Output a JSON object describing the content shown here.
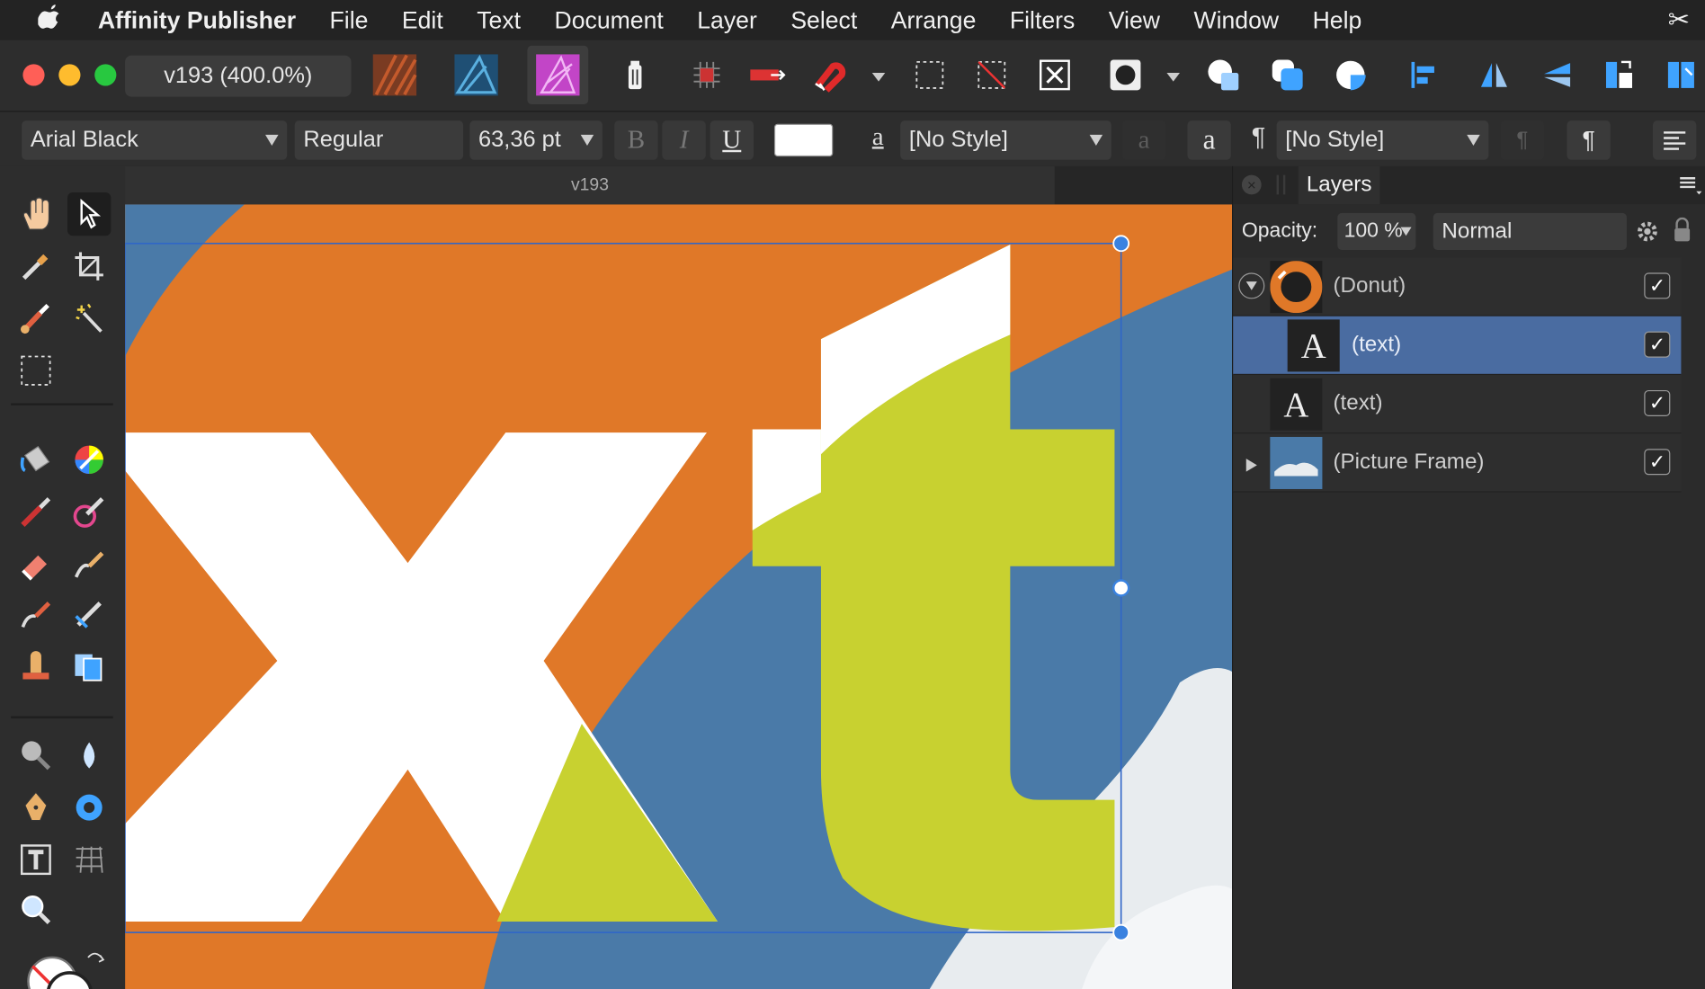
{
  "menubar": {
    "apple": "",
    "app_name": "Affinity Publisher",
    "items": [
      "File",
      "Edit",
      "Text",
      "Document",
      "Layer",
      "Select",
      "Arrange",
      "Filters",
      "View",
      "Window",
      "Help"
    ],
    "scissors": "✂"
  },
  "toolbar": {
    "document_label": "v193  (400.0%)"
  },
  "context": {
    "font_family": "Arial Black",
    "font_style": "Regular",
    "font_size": "63,36 pt",
    "bold": "B",
    "italic": "I",
    "underline": "U",
    "char_style_icon": "a",
    "char_style": "[No Style]",
    "char_btn_1": "a",
    "char_btn_2": "a",
    "para_icon": "¶",
    "para_style": "[No Style]",
    "para_btn_1": "¶",
    "para_btn_2": "¶",
    "fill_color": "#ffffff"
  },
  "document": {
    "tab_title": "v193",
    "colors": {
      "orange": "#e07828",
      "blue": "#4a7aa8",
      "lime": "#c8d130",
      "white": "#ffffff",
      "cloud": "#e8ecef"
    }
  },
  "layers_panel": {
    "tab": "Layers",
    "opacity_label": "Opacity:",
    "opacity_value": "100 %",
    "blend_mode": "Normal",
    "layers": [
      {
        "name": "(Donut)",
        "visible": "✓",
        "expanded": true
      },
      {
        "name": "(text)",
        "visible": "✓",
        "selected": true
      },
      {
        "name": "(text)",
        "visible": "✓"
      },
      {
        "name": "(Picture Frame)",
        "visible": "✓",
        "expanded": false
      }
    ]
  }
}
